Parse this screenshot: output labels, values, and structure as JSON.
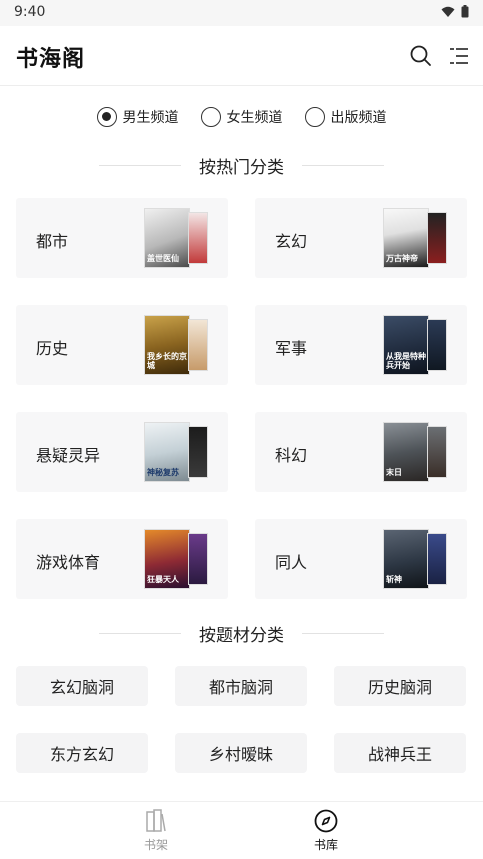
{
  "status_bar": {
    "time": "9:40"
  },
  "app_bar": {
    "title": "书海阁"
  },
  "channels": [
    {
      "label": "男生频道",
      "selected": true
    },
    {
      "label": "女生频道",
      "selected": false
    },
    {
      "label": "出版频道",
      "selected": false
    }
  ],
  "sections": {
    "hot": "按热门分类",
    "theme": "按题材分类"
  },
  "categories": [
    {
      "label": "都市",
      "cover_text": "盖世医仙",
      "cover_color": "#c9c9c9"
    },
    {
      "label": "玄幻",
      "cover_text": "万古神帝",
      "cover_color": "#e8e8e8"
    },
    {
      "label": "历史",
      "cover_text": "我乡长的京城",
      "cover_color": "#7a5b1c"
    },
    {
      "label": "军事",
      "cover_text": "从我是特种兵开始",
      "cover_color": "#2a3a52"
    },
    {
      "label": "悬疑灵异",
      "cover_text": "神秘复苏",
      "cover_color": "#cfd8dc"
    },
    {
      "label": "科幻",
      "cover_text": "末日",
      "cover_color": "#4b4f55"
    },
    {
      "label": "游戏体育",
      "cover_text": "狂暴天人",
      "cover_color": "#5a2030"
    },
    {
      "label": "同人",
      "cover_text": "斩神",
      "cover_color": "#2d3744"
    }
  ],
  "themes": [
    {
      "label": "玄幻脑洞"
    },
    {
      "label": "都市脑洞"
    },
    {
      "label": "历史脑洞"
    },
    {
      "label": "东方玄幻"
    },
    {
      "label": "乡村暧昧"
    },
    {
      "label": "战神兵王"
    }
  ],
  "bottom_nav": [
    {
      "label": "书架",
      "active": false
    },
    {
      "label": "书库",
      "active": true
    }
  ]
}
